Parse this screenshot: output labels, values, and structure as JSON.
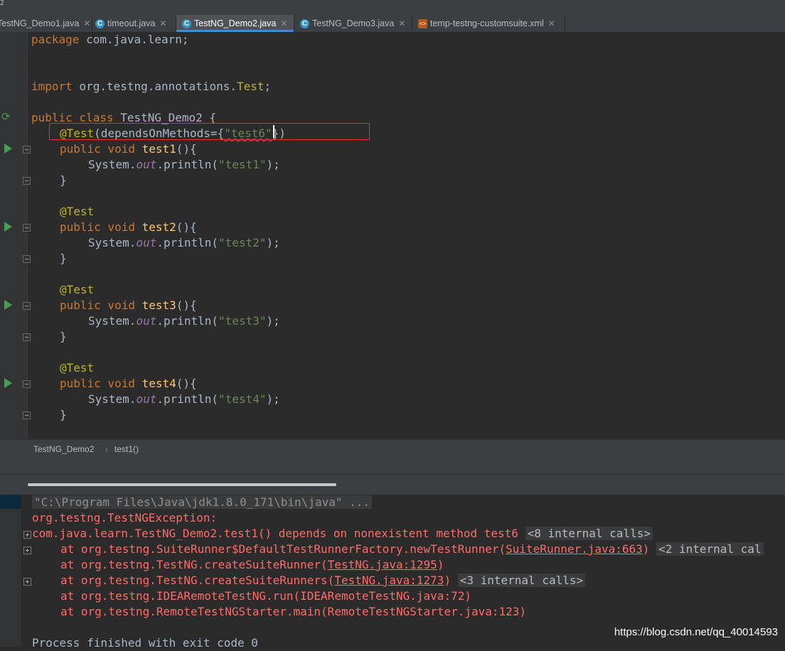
{
  "window": {
    "top_crumb": "2"
  },
  "tabs": [
    {
      "label": "TestNG_Demo1.java",
      "icon": "java-class-icon",
      "active": false
    },
    {
      "label": "timeout.java",
      "icon": "java-class-icon",
      "active": false
    },
    {
      "label": "TestNG_Demo2.java",
      "icon": "java-class-icon",
      "active": true
    },
    {
      "label": "TestNG_Demo3.java",
      "icon": "java-class-icon",
      "active": false
    },
    {
      "label": "temp-testng-customsuite.xml",
      "icon": "xml-file-icon",
      "active": false
    }
  ],
  "editor": {
    "code": [
      "package com.java.learn;",
      "import org.testng.annotations.Test;",
      "public class TestNG_Demo2 {",
      "@Test(dependsOnMethods={\"test6\"})",
      "public void test1(){",
      "System.out.println(\"test1\");",
      "}",
      "@Test",
      "public void test2(){",
      "System.out.println(\"test2\");",
      "}",
      "@Test",
      "public void test3(){",
      "System.out.println(\"test3\");",
      "}",
      "@Test",
      "public void test4(){",
      "System.out.println(\"test4\");",
      "}"
    ]
  },
  "breadcrumb": {
    "class_name": "TestNG_Demo2",
    "method_name": "test1()"
  },
  "console": {
    "command": "\"C:\\Program Files\\Java\\jdk1.8.0_171\\bin\\java\" ...",
    "exception": "org.testng.TestNGException:",
    "message": "com.java.learn.TestNG_Demo2.test1() depends on nonexistent method test6",
    "internal_8": "<8 internal calls>",
    "st1_prefix": "at org.testng.SuiteRunner$DefaultTestRunnerFactory.newTestRunner(",
    "st1_link": "SuiteRunner.java:663",
    "st1_suffix": ")",
    "internal_2": "<2 internal cal",
    "st2_prefix": "at org.testng.TestNG.createSuiteRunner(",
    "st2_link": "TestNG.java:1295",
    "st2_suffix": ")",
    "st3_prefix": "at org.testng.TestNG.createSuiteRunners(",
    "st3_link": "TestNG.java:1273",
    "st3_suffix": ")",
    "internal_3": "<3 internal calls>",
    "st4": "at org.testng.IDEARemoteTestNG.run(IDEARemoteTestNG.java:72)",
    "st5": "at org.testng.RemoteTestNGStarter.main(RemoteTestNGStarter.java:123)",
    "exit": "Process finished with exit code 0"
  },
  "watermark": "https://blog.csdn.net/qq_40014593"
}
